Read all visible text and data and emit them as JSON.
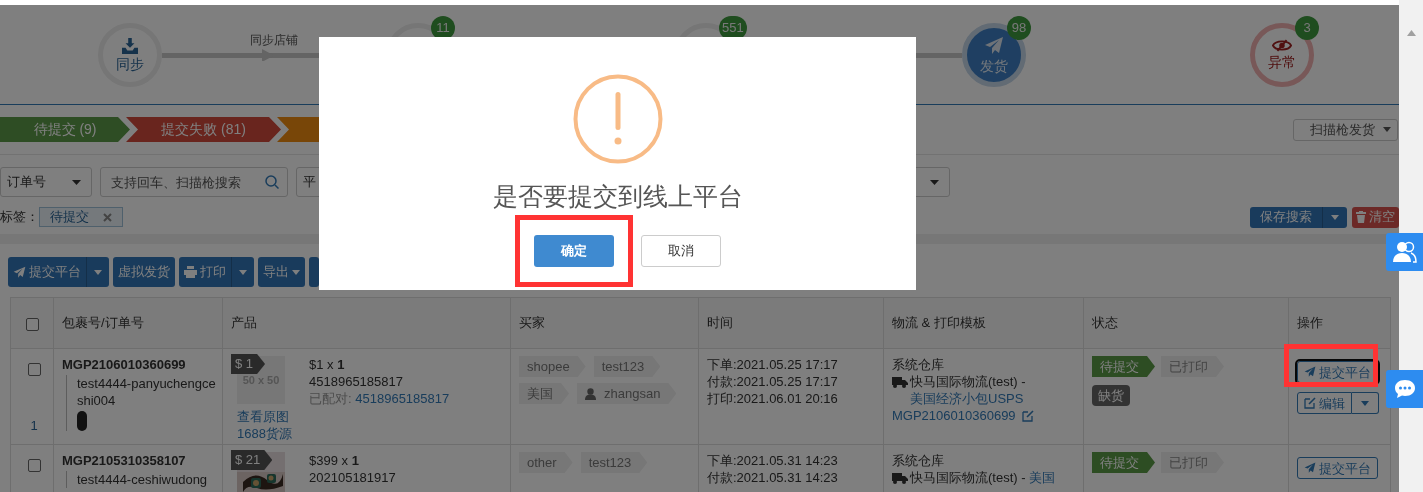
{
  "steps": [
    {
      "kind": "sync",
      "label": "同步",
      "selected": false,
      "linked": true,
      "connector_label": "同步店铺"
    },
    {
      "kind": "hidden",
      "badge": "11",
      "selected": false
    },
    {
      "kind": "hidden",
      "badge": "551",
      "selected": false,
      "linked": true
    },
    {
      "kind": "ship",
      "label": "发货",
      "badge": "98",
      "selected": true,
      "linked": false
    },
    {
      "kind": "alert",
      "label": "异常",
      "badge": "3",
      "selected": false,
      "linked": false
    }
  ],
  "filter_tabs": [
    {
      "label": "待提交 (9)",
      "kind": "pending"
    },
    {
      "label": "提交失败 (81)",
      "kind": "failed"
    },
    {
      "kind": "warning"
    }
  ],
  "scan_button": "扫描枪发货",
  "filters": [
    {
      "kind": "select",
      "value": "订单号"
    },
    {
      "kind": "search",
      "placeholder": "支持回车、扫描枪搜索"
    },
    {
      "kind": "select",
      "value": "平"
    }
  ],
  "tag_filter": {
    "label": "标签：",
    "tags": [
      "待提交"
    ]
  },
  "search_actions": {
    "save": "保存搜索",
    "clear": "清空"
  },
  "toolbar": [
    {
      "label": "提交平台",
      "kind": "split"
    },
    {
      "label": "虚拟发货",
      "kind": "plain"
    },
    {
      "label": "打印",
      "kind": "split"
    },
    {
      "label": "导出",
      "kind": "menu"
    },
    {
      "kind": "plain"
    }
  ],
  "table": {
    "header_checked": false,
    "columns": [
      "包裹号/订单号",
      "产品",
      "买家",
      "时间",
      "物流 & 打印模板",
      "状态",
      "操作"
    ],
    "rows": [
      {
        "checked": false,
        "package": "MGP2106010360699",
        "sub": "test4444-panyuchengceshi004",
        "index": "1",
        "price_tag": "$ 1",
        "thumb": {
          "kind": "placeholder",
          "text": "50 x 50"
        },
        "price": "$1",
        "times_sign": "x",
        "qty": "1",
        "sku": "4518965185817",
        "paired_label": "已配对:",
        "paired": "4518965185817",
        "links": [
          "查看原图",
          "1688货源"
        ],
        "buyer_tags": [
          {
            "label": "shopee",
            "kind": "plain"
          },
          {
            "label": "test123",
            "kind": "plain"
          },
          {
            "label": "美国",
            "kind": "plain"
          },
          {
            "label": "zhangsan",
            "kind": "user"
          }
        ],
        "times": [
          "下单:2021.05.25 17:17",
          "付款:2021.05.25 17:17",
          "打印:2021.06.01 20:16"
        ],
        "warehouse": "系统仓库",
        "carrier": "快马国际物流(test) - ",
        "service": "美国经济小包USPS",
        "tracking": "MGP2106010360699",
        "statuses": [
          {
            "label": "待提交",
            "kind": "pending"
          },
          {
            "label": "已打印",
            "kind": "printed"
          },
          {
            "label": "缺货",
            "kind": "stock"
          }
        ],
        "submit": "提交平台",
        "edit": "编辑",
        "highlighted": true
      },
      {
        "checked": false,
        "package": "MGP2105310358107",
        "sub": "test4444-ceshiwudong",
        "price_tag": "$ 21",
        "thumb": {
          "kind": "picture"
        },
        "price": "$399",
        "times_sign": "x",
        "qty": "1",
        "sku": "202105181917",
        "buyer_tags": [
          {
            "label": "other",
            "kind": "plain"
          },
          {
            "label": "test123",
            "kind": "plain"
          }
        ],
        "times": [
          "下单:2021.05.31 14:23",
          "付款:2021.05.31 14:23"
        ],
        "warehouse": "系统仓库",
        "carrier": "快马国际物流(test) - ",
        "service": "美国",
        "statuses": [
          {
            "label": "待提交",
            "kind": "pending"
          },
          {
            "label": "已打印",
            "kind": "printed"
          }
        ],
        "submit": "提交平台",
        "highlighted": false
      }
    ]
  },
  "modal": {
    "title": "是否要提交到线上平台",
    "confirm": "确定",
    "cancel": "取消",
    "confirm_highlighted": true
  }
}
